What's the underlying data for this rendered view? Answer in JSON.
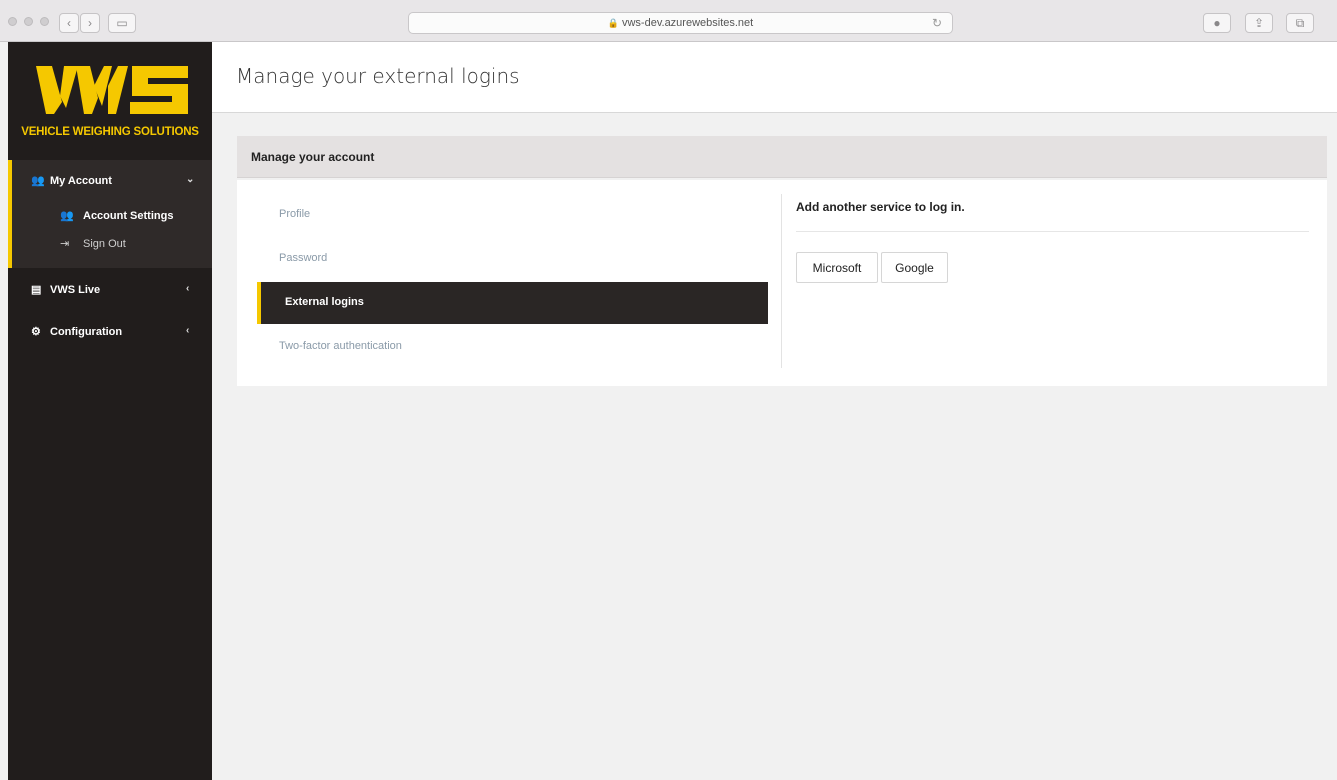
{
  "browser": {
    "url": "vws-dev.azurewebsites.net"
  },
  "logo": {
    "text": "VEHICLE WEIGHING SOLUTIONS",
    "color": "#f5c800"
  },
  "sidebar": {
    "items": [
      {
        "label": "My Account",
        "icon": "user-cog-icon"
      },
      {
        "label": "VWS Live",
        "icon": "monitor-icon"
      },
      {
        "label": "Configuration",
        "icon": "cogs-icon"
      }
    ],
    "subitems": [
      {
        "label": "Account Settings",
        "icon": "user-cog-icon"
      },
      {
        "label": "Sign Out",
        "icon": "sign-out-icon"
      }
    ]
  },
  "header": {
    "title": "Manage your external logins"
  },
  "panel": {
    "title": "Manage your account",
    "tabs": [
      {
        "label": "Profile"
      },
      {
        "label": "Password"
      },
      {
        "label": "External logins",
        "active": true
      },
      {
        "label": "Two-factor authentication"
      }
    ],
    "external": {
      "heading": "Add another service to log in.",
      "providers": [
        "Microsoft",
        "Google"
      ]
    }
  },
  "colors": {
    "accent": "#f5c800",
    "sidebar_bg": "#211d1c",
    "active_tab_bg": "#2a2625"
  }
}
